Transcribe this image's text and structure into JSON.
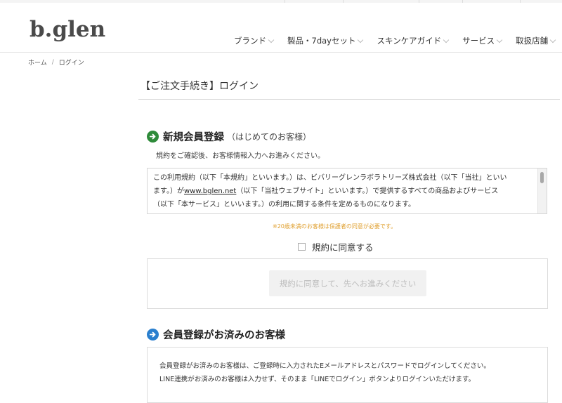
{
  "site": {
    "logo": "b.glen"
  },
  "nav": [
    {
      "label": "ブランド"
    },
    {
      "label": "製品・7dayセット"
    },
    {
      "label": "スキンケアガイド"
    },
    {
      "label": "サービス"
    },
    {
      "label": "取扱店舗"
    }
  ],
  "breadcrumb": {
    "home": "ホーム",
    "separator": "/",
    "current": "ログイン"
  },
  "page": {
    "title": "【ご注文手続き】ログイン"
  },
  "new_member": {
    "icon": "arrow-right-circle-icon",
    "icon_color": "#2e8b3a",
    "title": "新規会員登録",
    "subtitle": "（はじめてのお客様）",
    "instruction": "規約をご確認後、お客様情報入力へお進みください。",
    "terms": {
      "line1": "この利用規約（以下「本規約」といいます。）は、ビバリーグレンラボラトリーズ株式会社（以下「当社」といい",
      "line2_prefix": "ます。）が",
      "link": "www.bglen.net",
      "line2_suffix": "（以下「当社ウェブサイト」といいます。）で提供するすべての商品およびサービス",
      "line3": "（以下「本サービス」といいます。）の利用に関する条件を定めるものになります。"
    },
    "age_notice": "※20歳未満のお客様は保護者の同意が必要です。",
    "notice_color": "#e0a030",
    "agree_label": "規約に同意する",
    "agree_checked": false,
    "proceed_button": "規約に同意して、先へお進みください"
  },
  "existing_member": {
    "icon": "arrow-right-circle-icon",
    "icon_color": "#2a7fce",
    "title": "会員登録がお済みのお客様",
    "text_line1": "会員登録がお済みのお客様は、ご登録時に入力されたEメールアドレスとパスワードでログインしてください。",
    "text_line2": "LINE連携がお済みのお客様は入力せず、そのまま「LINEでログイン」ボタンよりログインいただけます。"
  }
}
